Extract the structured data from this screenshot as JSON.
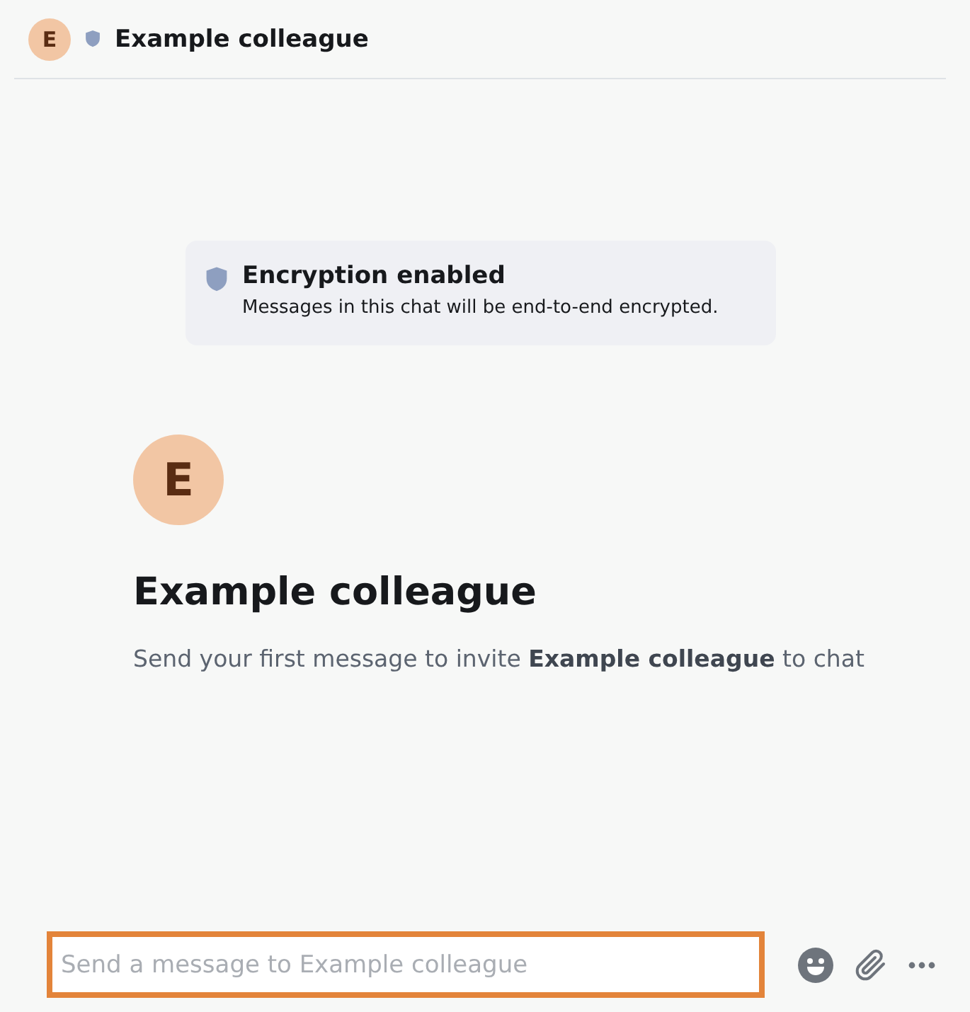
{
  "header": {
    "avatar_letter": "E",
    "title": "Example colleague"
  },
  "notice": {
    "title": "Encryption enabled",
    "text": "Messages in this chat will be end-to-end encrypted."
  },
  "intro": {
    "avatar_letter": "E",
    "name": "Example colleague",
    "text": "Send your first message to invite **Example colleague** to chat"
  },
  "composer": {
    "placeholder": "Send a message to Example colleague",
    "focused": true
  }
}
